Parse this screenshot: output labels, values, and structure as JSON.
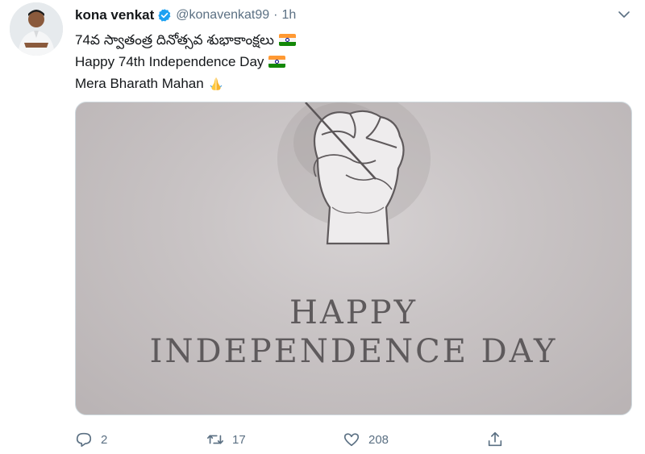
{
  "tweet": {
    "display_name": "kona venkat",
    "handle": "@konavenkat99",
    "separator": "·",
    "time": "1h",
    "verified": true,
    "lines": [
      "74వ స్వాతంత్ర దినోత్సవ శుభాకాంక్షలు",
      "Happy 74th Independence Day",
      "Mera Bharath Mahan"
    ],
    "media": {
      "heading_line1": "HAPPY",
      "heading_line2": "INDEPENDENCE DAY"
    },
    "actions": {
      "reply_count": "2",
      "retweet_count": "17",
      "like_count": "208"
    }
  },
  "colors": {
    "verified": "#1da1f2",
    "muted": "#5b7083",
    "media_text": "#5e5a5c"
  },
  "icons": [
    "avatar",
    "verified-badge-icon",
    "chevron-down-icon",
    "india-flag-icon",
    "folded-hands-icon",
    "reply-icon",
    "retweet-icon",
    "like-icon",
    "share-icon"
  ]
}
